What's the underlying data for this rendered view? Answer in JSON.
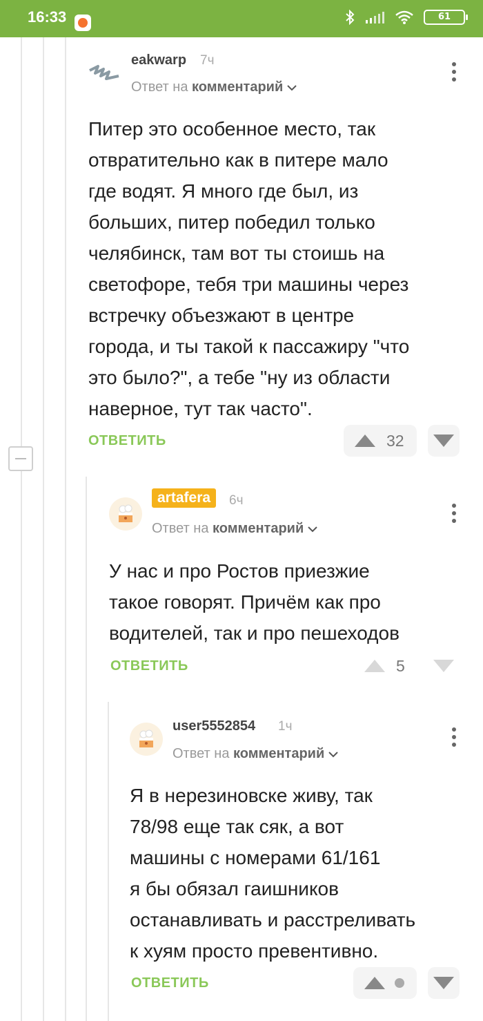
{
  "status_bar": {
    "time": "16:33",
    "battery": "61"
  },
  "collapse_label": "−",
  "comments": [
    {
      "username": "eakwarp",
      "time": "7ч",
      "reply_prefix": "Ответ на",
      "reply_target": "комментарий",
      "text": "Питер это особенное место, так\nотвратительно как в питере мало\nгде водят. Я много где был, из\nбольших, питер победил только\nчелябинск, там вот ты стоишь на\nсветофоре, тебя три машины через\nвстречку объезжают в центре\nгорода, и ты такой к пассажиру \"что\nэто было?\", а тебе \"ну из области\nнаверное, тут так часто\".",
      "reply_label": "ОТВЕТИТЬ",
      "rating": "32"
    },
    {
      "username": "artafera",
      "time": "6ч",
      "reply_prefix": "Ответ на",
      "reply_target": "комментарий",
      "text": "У нас и про Ростов приезжие\nтакое говорят. Причём как про\nводителей, так и про пешеходов",
      "reply_label": "ОТВЕТИТЬ",
      "rating": "5"
    },
    {
      "username": "user5552854",
      "time": "1ч",
      "reply_prefix": "Ответ на",
      "reply_target": "комментарий",
      "text": "Я в нерезиновске живу, так\n78/98 еще так сяк, а вот\nмашины с номерами 61/161\nя бы обязал гаишников\nостанавливать и расстреливать\nк хуям просто превентивно.",
      "reply_label": "ОТВЕТИТЬ",
      "rating": ""
    }
  ],
  "colors": {
    "status_bar": "#7cb342",
    "reply_button": "#8ac858",
    "badge": "#f5b21b"
  }
}
